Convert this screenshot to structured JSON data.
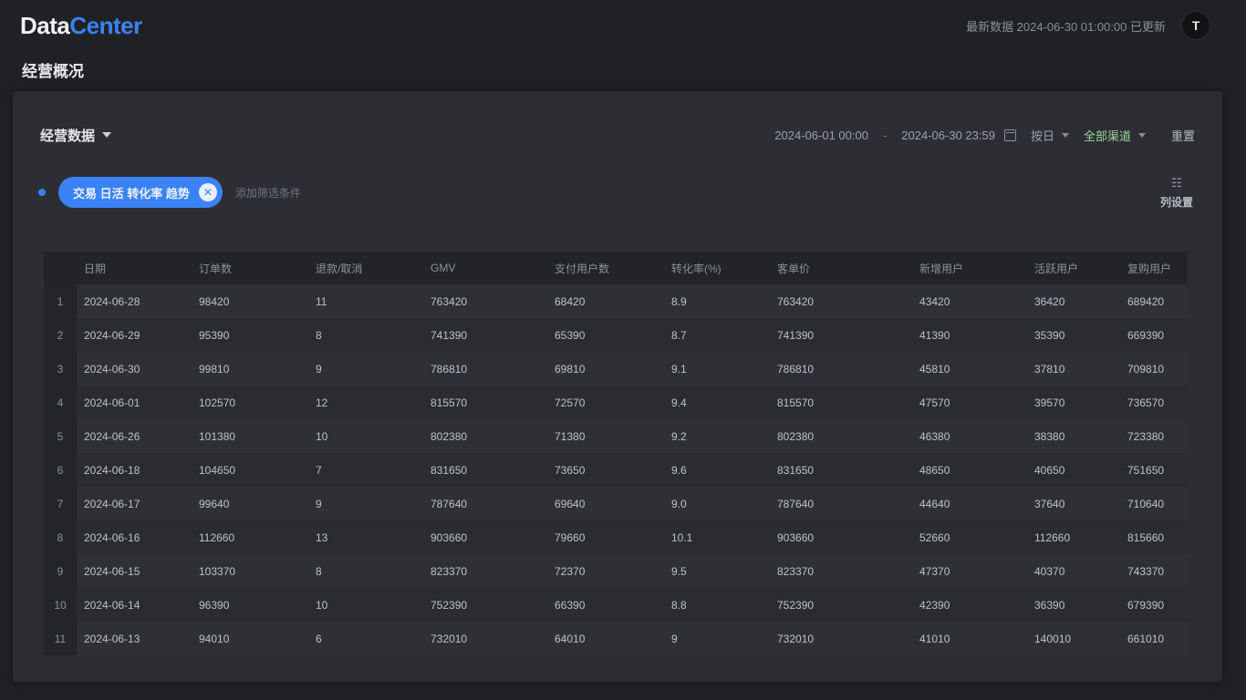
{
  "app": {
    "logo_primary": "Data",
    "logo_accent": "Center",
    "accent_color": "#3b82f6"
  },
  "header": {
    "update_text": "最新数据 2024-06-30 01:00:00 已更新",
    "avatar_initial": "T"
  },
  "page": {
    "title": "经营概况"
  },
  "toolbar": {
    "dataset_label": "经营数据",
    "start_date": "2024-06-01 00:00",
    "end_date": "2024-06-30 23:59",
    "range_sep": "-",
    "granularity": "按日",
    "metric_filter": "全部渠道",
    "reset_label": "重置"
  },
  "chips": [
    {
      "label": "交易 日活 转化率 趋势"
    }
  ],
  "chip_hint": "添加筛选条件",
  "column_settings": {
    "icon": "☷",
    "label": "列设置"
  },
  "table": {
    "columns": [
      "日期",
      "订单数",
      "退款/取消",
      "GMV",
      "支付用户数",
      "转化率(%)",
      "客单价",
      "新增用户",
      "活跃用户",
      "复购用户"
    ],
    "rows": [
      [
        "1",
        "2024-06-28",
        "98420",
        "11",
        "763420",
        "68420",
        "8.9",
        "763420",
        "43420",
        "36420",
        "689420"
      ],
      [
        "2",
        "2024-06-29",
        "95390",
        "8",
        "741390",
        "65390",
        "8.7",
        "741390",
        "41390",
        "35390",
        "669390"
      ],
      [
        "3",
        "2024-06-30",
        "99810",
        "9",
        "786810",
        "69810",
        "9.1",
        "786810",
        "45810",
        "37810",
        "709810"
      ],
      [
        "4",
        "2024-06-01",
        "102570",
        "12",
        "815570",
        "72570",
        "9.4",
        "815570",
        "47570",
        "39570",
        "736570"
      ],
      [
        "5",
        "2024-06-26",
        "101380",
        "10",
        "802380",
        "71380",
        "9.2",
        "802380",
        "46380",
        "38380",
        "723380"
      ],
      [
        "6",
        "2024-06-18",
        "104650",
        "7",
        "831650",
        "73650",
        "9.6",
        "831650",
        "48650",
        "40650",
        "751650"
      ],
      [
        "7",
        "2024-06-17",
        "99640",
        "9",
        "787640",
        "69640",
        "9.0",
        "787640",
        "44640",
        "37640",
        "710640"
      ],
      [
        "8",
        "2024-06-16",
        "112660",
        "13",
        "903660",
        "79660",
        "10.1",
        "903660",
        "52660",
        "112660",
        "815660"
      ],
      [
        "9",
        "2024-06-15",
        "103370",
        "8",
        "823370",
        "72370",
        "9.5",
        "823370",
        "47370",
        "40370",
        "743370"
      ],
      [
        "10",
        "2024-06-14",
        "96390",
        "10",
        "752390",
        "66390",
        "8.8",
        "752390",
        "42390",
        "36390",
        "679390"
      ],
      [
        "11",
        "2024-06-13",
        "94010",
        "6",
        "732010",
        "64010",
        "9",
        "732010",
        "41010",
        "140010",
        "661010"
      ]
    ]
  }
}
